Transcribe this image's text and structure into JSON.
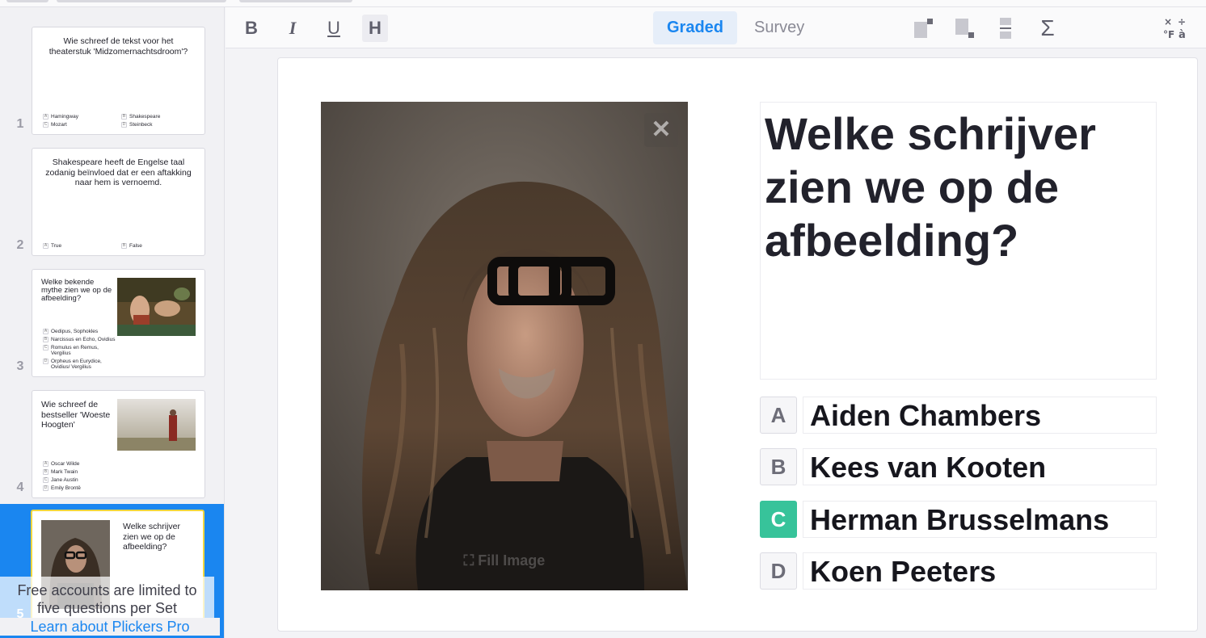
{
  "sidebar": {
    "slides": [
      {
        "number": "1",
        "question": "Wie schreef de tekst voor het theaterstuk 'Midzomernachtsdroom'?",
        "choices": [
          {
            "letter": "A",
            "text": "Hamingway"
          },
          {
            "letter": "B",
            "text": "Shakespeare"
          },
          {
            "letter": "C",
            "text": "Mozart"
          },
          {
            "letter": "D",
            "text": "Steinbeck"
          }
        ]
      },
      {
        "number": "2",
        "question": "Shakespeare heeft de Engelse taal zodanig beïnvloed dat er een aftakking naar hem is vernoemd.",
        "choices": [
          {
            "letter": "A",
            "text": "True"
          },
          {
            "letter": "B",
            "text": "False"
          }
        ]
      },
      {
        "number": "3",
        "question": "Welke bekende mythe zien we op de afbeelding?",
        "choices": [
          {
            "letter": "A",
            "text": "Oedipus, Sophokles"
          },
          {
            "letter": "B",
            "text": "Narcissus en Echo, Ovidius"
          },
          {
            "letter": "C",
            "text": "Romulus en Remus, Vergilius"
          },
          {
            "letter": "D",
            "text": "Orpheus en Eurydice, Ovidius/ Vergilius"
          }
        ]
      },
      {
        "number": "4",
        "question": "Wie schreef de bestseller 'Woeste Hoogten'",
        "choices": [
          {
            "letter": "A",
            "text": "Oscar Wilde"
          },
          {
            "letter": "B",
            "text": "Mark Twain"
          },
          {
            "letter": "C",
            "text": "Jane Austin"
          },
          {
            "letter": "D",
            "text": "Emily Brontë"
          }
        ]
      },
      {
        "number": "5",
        "question": "Welke schrijver zien we op de afbeelding?"
      }
    ],
    "pro_banner": "Free accounts are limited to five questions per Set",
    "pro_link": "Learn about Plickers Pro"
  },
  "toolbar": {
    "bold": "B",
    "italic": "I",
    "underline": "U",
    "heading": "H",
    "mode_graded": "Graded",
    "mode_survey": "Survey",
    "sigma": "Σ"
  },
  "editor": {
    "question": "Welke schrijver zien we op de afbeelding?",
    "image_close": "✕",
    "image_fill_label": "Fill Image",
    "choices": [
      {
        "letter": "A",
        "text": "Aiden Chambers",
        "correct": false
      },
      {
        "letter": "B",
        "text": "Kees van Kooten",
        "correct": false
      },
      {
        "letter": "C",
        "text": "Herman Brusselmans",
        "correct": true
      },
      {
        "letter": "D",
        "text": "Koen Peeters",
        "correct": false
      }
    ],
    "correct_color": "#37c39a",
    "accent_color": "#1a86f0"
  }
}
